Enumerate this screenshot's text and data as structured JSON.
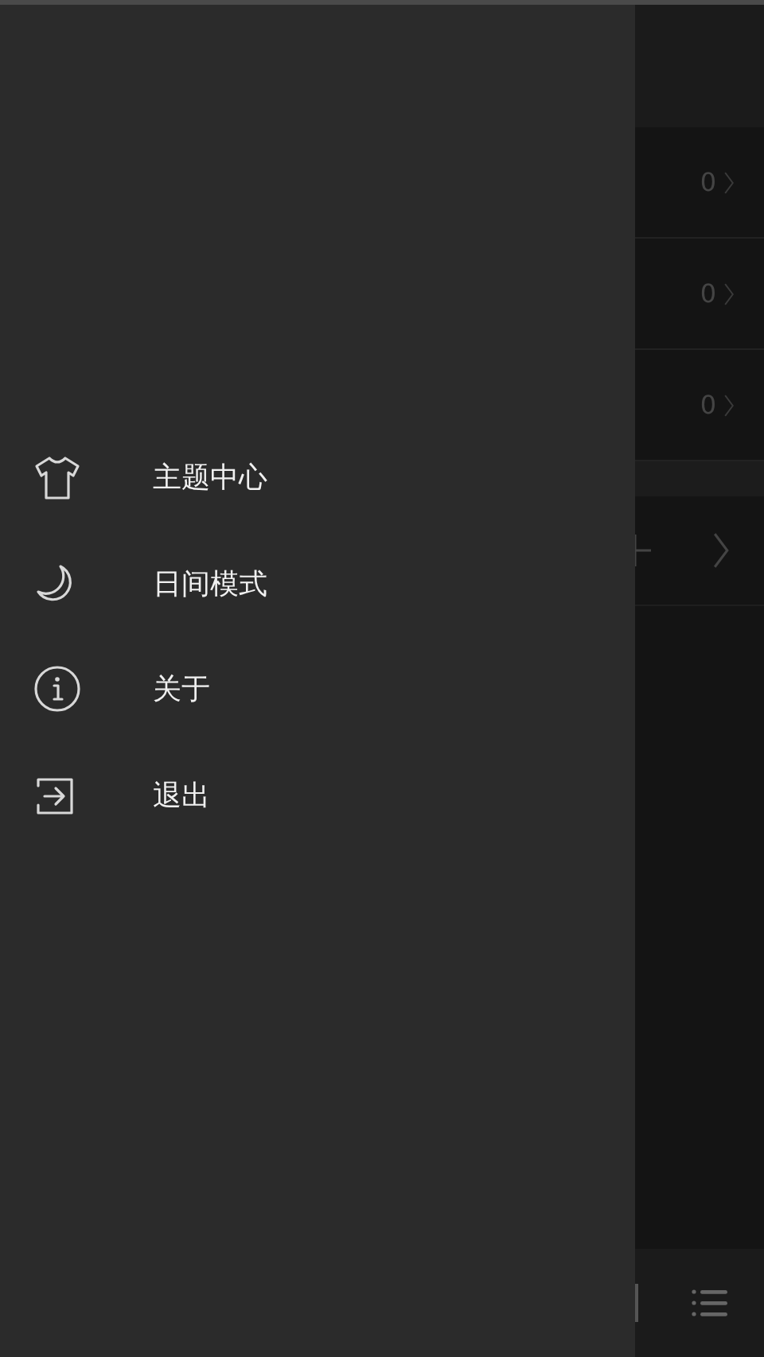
{
  "drawer": {
    "items": [
      {
        "kind": "shirt",
        "label": "主题中心"
      },
      {
        "kind": "moon",
        "label": "日间模式"
      },
      {
        "kind": "info",
        "label": "关于"
      },
      {
        "kind": "exit",
        "label": "退出"
      }
    ]
  },
  "background": {
    "rows": [
      {
        "value": "0"
      },
      {
        "value": "0"
      },
      {
        "value": "0"
      }
    ]
  }
}
